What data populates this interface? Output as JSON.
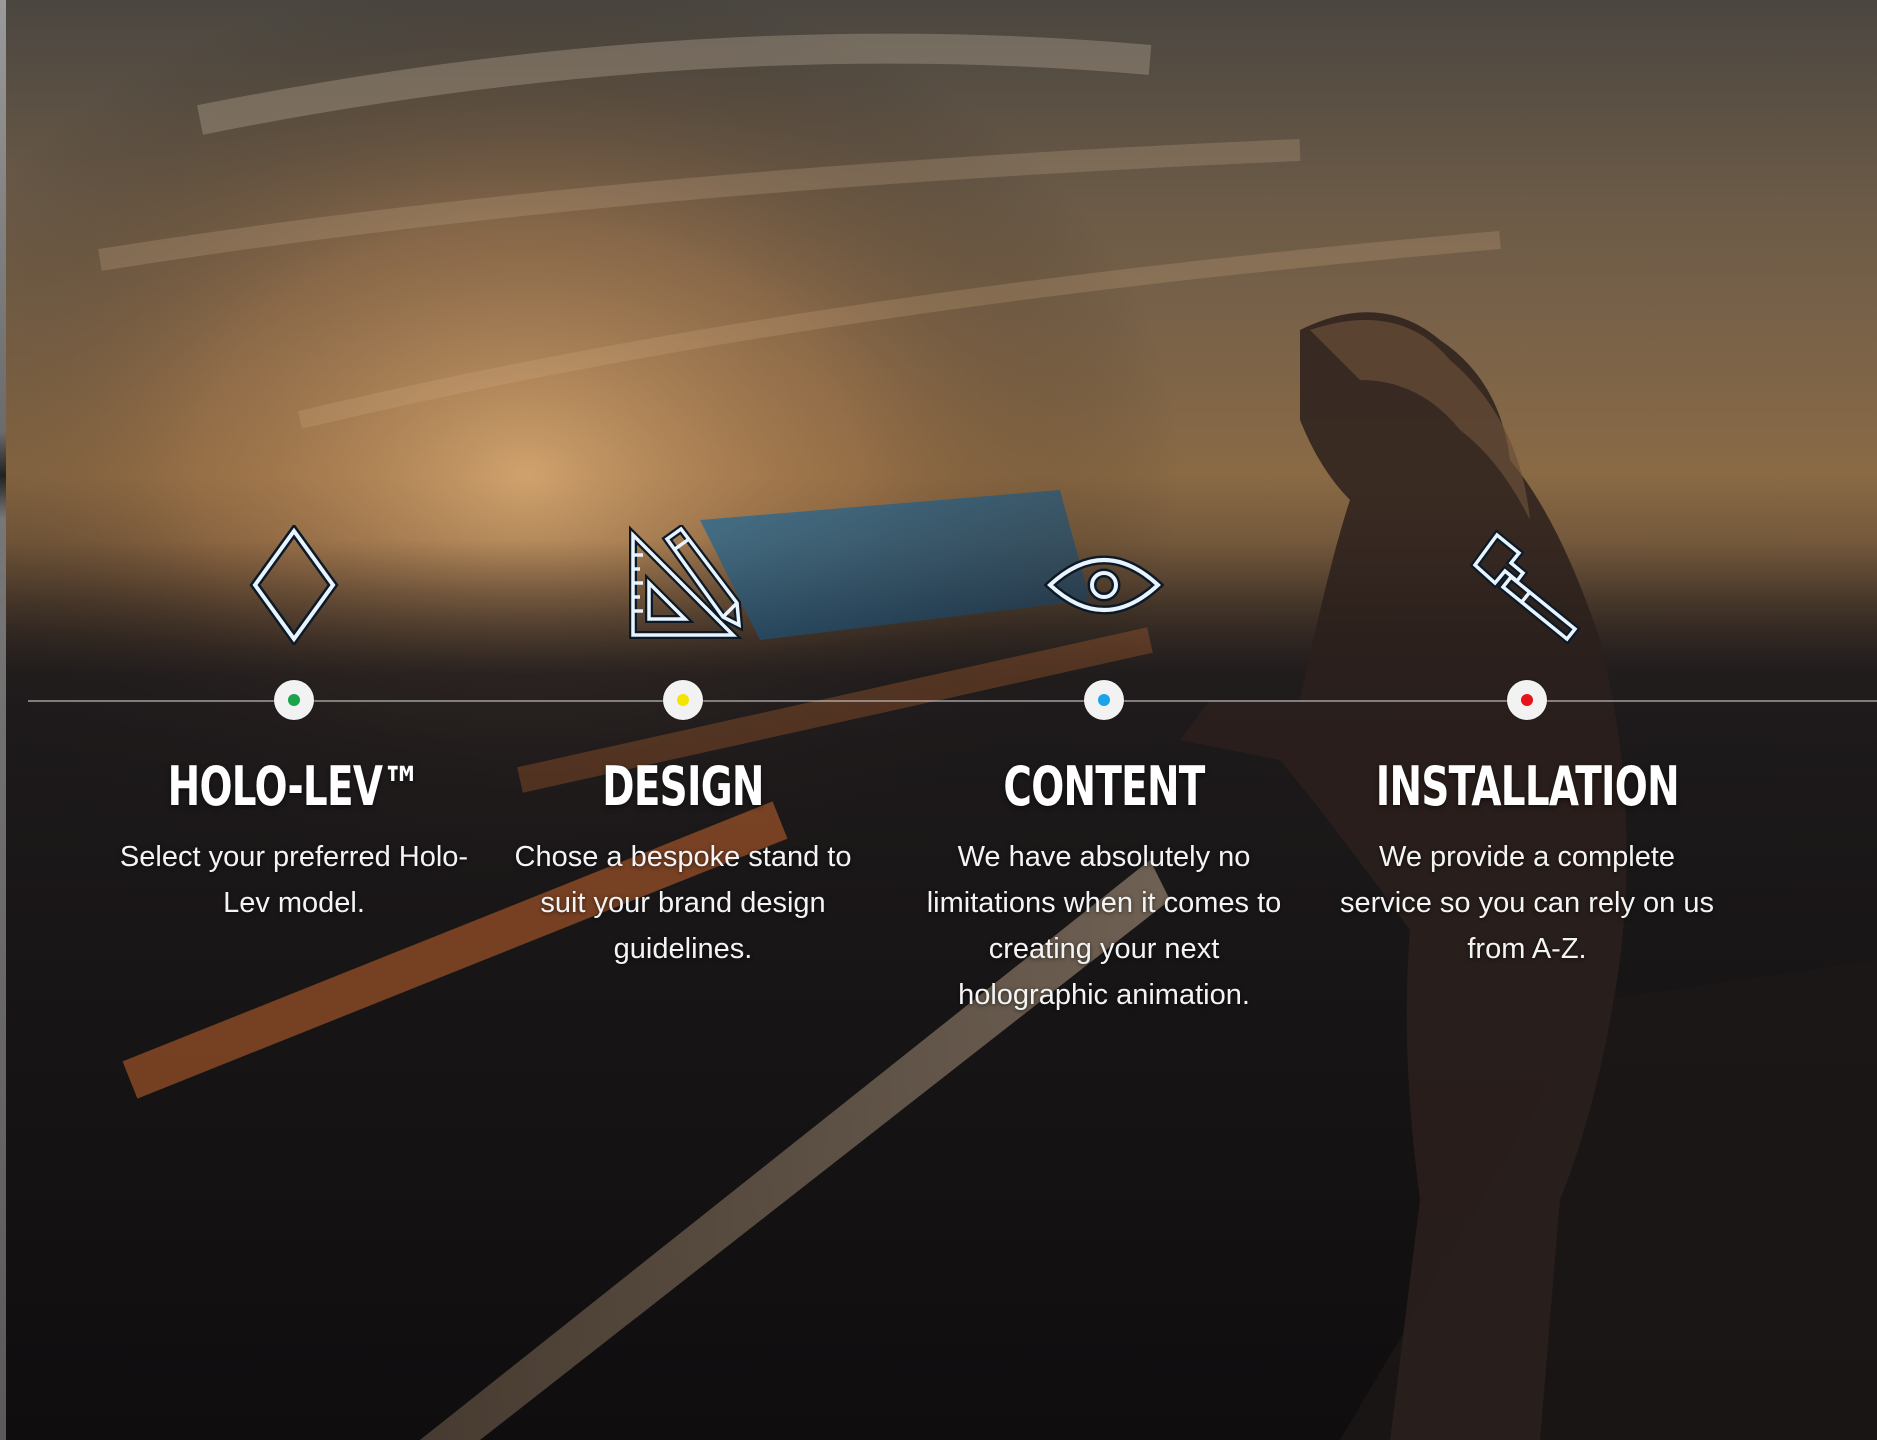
{
  "steps": [
    {
      "title": "HOLO-LEV™",
      "description": "Select your preferred Holo-Lev model.",
      "icon": "diamond-icon",
      "dot_color": "#1aa34a"
    },
    {
      "title": "DESIGN",
      "description": "Chose a bespoke stand to suit your brand design guidelines.",
      "icon": "set-square-pencil-icon",
      "dot_color": "#f5e400"
    },
    {
      "title": "CONTENT",
      "description": "We have absolutely no limitations when it comes to creating your next holographic animation.",
      "icon": "eye-icon",
      "dot_color": "#1aa3e8"
    },
    {
      "title": "INSTALLATION",
      "description": "We provide a complete service so you can rely on us from A-Z.",
      "icon": "hammer-icon",
      "dot_color": "#e8121c"
    }
  ]
}
